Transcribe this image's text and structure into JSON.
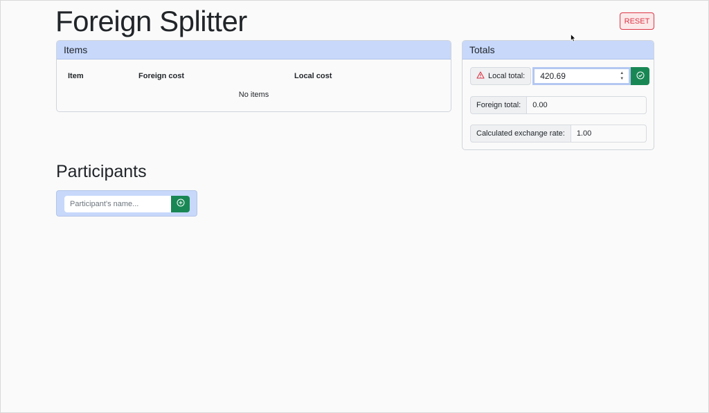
{
  "app": {
    "title": "Foreign Splitter",
    "reset_label": "RESET"
  },
  "items_card": {
    "header": "Items",
    "columns": [
      "Item",
      "Foreign cost",
      "Local cost"
    ],
    "empty_text": "No items"
  },
  "totals_card": {
    "header": "Totals",
    "local_total_label": "Local total:",
    "local_total_value": "420.69",
    "foreign_total_label": "Foreign total:",
    "foreign_total_value": "0.00",
    "exchange_rate_label": "Calculated exchange rate:",
    "exchange_rate_value": "1.00"
  },
  "participants": {
    "title": "Participants",
    "name_placeholder": "Participant's name..."
  },
  "icons": {
    "warning": "warning-triangle-icon",
    "confirm": "check-circle-icon",
    "add": "plus-circle-icon",
    "spinner": "number-spinner-icon"
  },
  "colors": {
    "accent_header": "#c7d8fb",
    "success": "#198754",
    "danger": "#dc3545"
  }
}
